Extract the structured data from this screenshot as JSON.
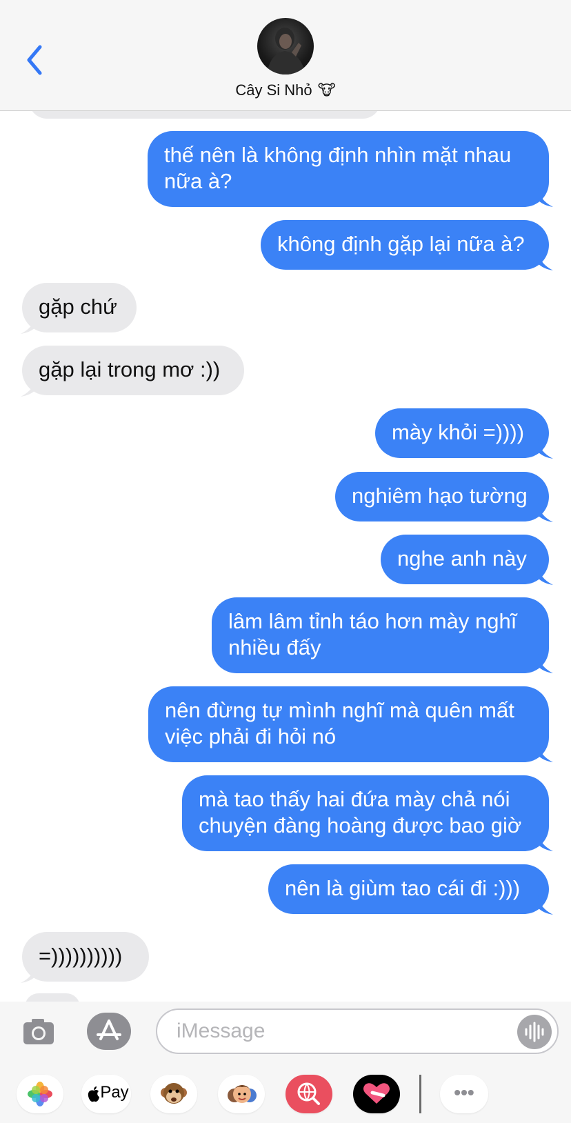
{
  "header": {
    "contact_name": "Cây Si Nhỏ",
    "contact_emoji": "🐮"
  },
  "messages": [
    {
      "from": "me",
      "text": "thế nên là không định nhìn mặt nhau\nnữa à?"
    },
    {
      "from": "me",
      "text": "không định gặp lại nữa à?"
    },
    {
      "from": "them",
      "text": "gặp chứ"
    },
    {
      "from": "them",
      "text": "gặp lại trong mơ :))"
    },
    {
      "from": "me",
      "text": "mày khỏi =))))"
    },
    {
      "from": "me",
      "text": "nghiêm hạo tường"
    },
    {
      "from": "me",
      "text": "nghe anh này"
    },
    {
      "from": "me",
      "text": "lâm lâm tỉnh táo hơn mày nghĩ\nnhiều đấy"
    },
    {
      "from": "me",
      "text": "nên đừng tự mình nghĩ mà quên mất\nviệc phải đi hỏi nó"
    },
    {
      "from": "me",
      "text": "mà tao thấy hai đứa mày chả nói\nchuyện đàng hoàng được bao giờ"
    },
    {
      "from": "me",
      "text": "nên là giùm tao cái đi :)))"
    },
    {
      "from": "them",
      "text": "=))))))))))"
    }
  ],
  "compose": {
    "placeholder": "iMessage"
  },
  "apps": {
    "pay_label": "Pay",
    "more_label": "•••"
  },
  "colors": {
    "outgoing_bubble": "#3b82f6",
    "incoming_bubble": "#e9e9eb",
    "accent_blue": "#3478f6",
    "header_bg": "#f6f6f6"
  },
  "icons": [
    "back-chevron-icon",
    "camera-icon",
    "app-store-icon",
    "mic-waveform-icon",
    "photos-icon",
    "apple-pay-icon",
    "monkey-emoji-icon",
    "memoji-icon",
    "search-globe-icon",
    "heart-sticker-icon",
    "more-icon"
  ]
}
